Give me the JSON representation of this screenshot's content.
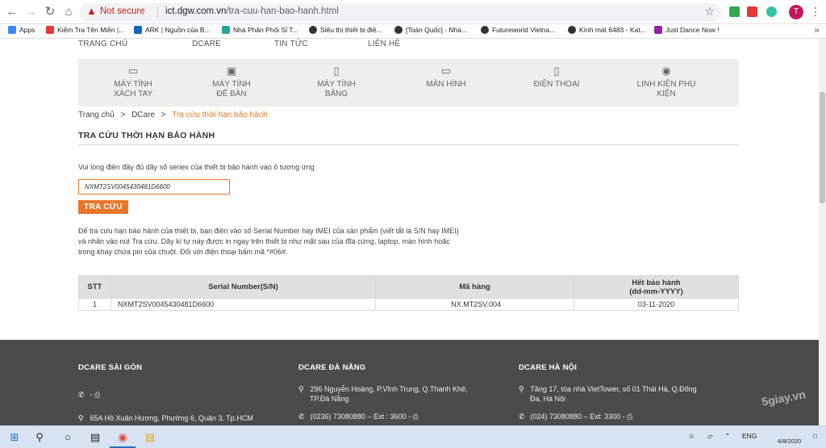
{
  "browser": {
    "security_label": "Not secure",
    "url_host": "ict.dgw.com.vn",
    "url_path": "/tra-cuu-han-bao-hanh.html",
    "avatar_letter": "T",
    "bookmarks": [
      {
        "label": "Apps",
        "color": "#4285f4"
      },
      {
        "label": "Kiểm Tra Tên Miền |...",
        "color": "#e53935"
      },
      {
        "label": "ARK | Nguồn của B...",
        "color": "#1565c0"
      },
      {
        "label": "Nhà Phân Phối Sỉ T...",
        "color": "#26a69a"
      },
      {
        "label": "Siêu thị thiết bị điệ...",
        "color": "#333333"
      },
      {
        "label": "[Toàn Quốc] - Nhà...",
        "color": "#333333"
      },
      {
        "label": "Futureworld Vietna...",
        "color": "#333333"
      },
      {
        "label": "Kính mát 6483 - Kat...",
        "color": "#333333"
      },
      {
        "label": "Just Dance Now !",
        "color": "#8e24aa"
      }
    ]
  },
  "site": {
    "top_menu": [
      "TRANG CHỦ",
      "DCARE",
      "TIN TỨC",
      "LIÊN HỆ"
    ],
    "categories": [
      {
        "label_1": "MÁY TÍNH",
        "label_2": "XÁCH TAY",
        "icon": "laptop-icon"
      },
      {
        "label_1": "MÁY TÍNH",
        "label_2": "ĐỂ BÀN",
        "icon": "desktop-icon"
      },
      {
        "label_1": "MÁY TÍNH",
        "label_2": "BẢNG",
        "icon": "tablet-icon"
      },
      {
        "label_1": "MÀN HÌNH",
        "label_2": "",
        "icon": "monitor-icon"
      },
      {
        "label_1": "ĐIỆN THOẠI",
        "label_2": "",
        "icon": "phone-icon"
      },
      {
        "label_1": "LINH KIỆN PHỤ",
        "label_2": "KIỆN",
        "icon": "accessory-icon"
      }
    ],
    "breadcrumb": {
      "home": "Trang chủ",
      "sep": ">",
      "section": "DCare",
      "current": "Tra cứu thời hạn bảo hành"
    },
    "section_title": "TRA CỨU THỜI HẠN BẢO HÀNH",
    "hint": "Vui lòng điền đầy đủ dãy số series của thiết bị bảo hành vào ô tương ứng",
    "serial_value": "NXMT2SV0045430481D6600",
    "search_button": "TRA CỨU",
    "description": "Để tra cứu hạn bảo hành của thiết bị, bạn điền vào số Serial Number hay IMEI của sản phẩm (viết tắt là S/N hay IMEI) và nhấn vào nút Tra cứu. Dãy kí tự này được in ngay trên thiết bị như mặt sau của đĩa cứng, laptop, màn hình hoặc trong khay chứa pin của chuột. Đối với điện thoại bấm mã *#06#.",
    "table": {
      "headers": {
        "stt": "STT",
        "serial": "Serial Number(S/N)",
        "code": "Mã hàng",
        "expiry_1": "Hết bảo hành",
        "expiry_2": "(dd-mm-YYYY)"
      },
      "rows": [
        {
          "stt": "1",
          "serial": "NXMT2SV0045430481D6600",
          "code": "NX.MT2SV.004",
          "expiry": "03-11-2020"
        }
      ]
    },
    "footer": {
      "sai_gon": {
        "title": "DCARE SÀI GÒN",
        "phone": "-",
        "address": "65A Hồ Xuân Hương, Phường 6, Quận 3, Tp.HCM"
      },
      "da_nang": {
        "title": "DCARE ĐÀ NẴNG",
        "address_1": "296 Nguyễn Hoàng, P.Vĩnh Trung, Q.Thanh Khê,",
        "address_2": "TP.Đà Nẵng",
        "phone": "(0236) 73080880 – Ext : 3600  -"
      },
      "ha_noi": {
        "title": "DCARE HÀ NỘI",
        "address_1": "Tầng 17, tòa nhà VietTower, số 01 Thái Hà, Q.Đống",
        "address_2": "Đa, Hà Nội",
        "phone": "(024) 73080880 – Ext: 3300  -"
      }
    }
  },
  "taskbar": {
    "language": "ENG",
    "date": "4/8/2020"
  },
  "watermark": "5giay.vn"
}
